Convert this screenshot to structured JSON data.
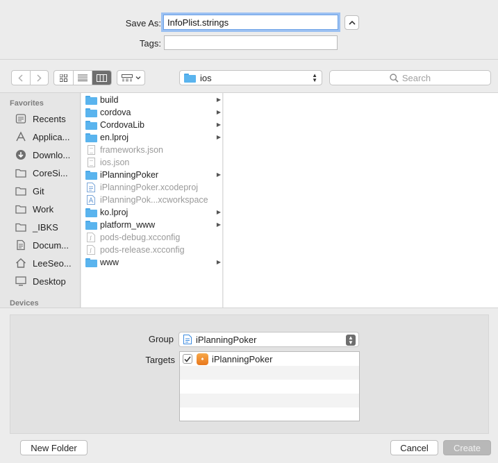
{
  "save": {
    "label": "Save As:",
    "value": "InfoPlist.strings",
    "tags_label": "Tags:",
    "tags_value": ""
  },
  "toolbar": {
    "location": "ios",
    "search_placeholder": "Search"
  },
  "sidebar": {
    "favorites_heading": "Favorites",
    "devices_heading": "Devices",
    "items": [
      {
        "label": "Recents",
        "icon": "recents-icon"
      },
      {
        "label": "Applica...",
        "icon": "applications-icon"
      },
      {
        "label": "Downlo...",
        "icon": "downloads-icon"
      },
      {
        "label": "CoreSi...",
        "icon": "folder-icon"
      },
      {
        "label": "Git",
        "icon": "folder-icon"
      },
      {
        "label": "Work",
        "icon": "folder-icon"
      },
      {
        "label": "_IBKS",
        "icon": "folder-icon"
      },
      {
        "label": "Docum...",
        "icon": "documents-icon"
      },
      {
        "label": "LeeSeo...",
        "icon": "home-icon"
      },
      {
        "label": "Desktop",
        "icon": "desktop-icon"
      }
    ]
  },
  "files": [
    {
      "name": "build",
      "type": "folder",
      "enabled": true
    },
    {
      "name": "cordova",
      "type": "folder",
      "enabled": true
    },
    {
      "name": "CordovaLib",
      "type": "folder",
      "enabled": true
    },
    {
      "name": "en.lproj",
      "type": "folder",
      "enabled": true
    },
    {
      "name": "frameworks.json",
      "type": "file",
      "enabled": false
    },
    {
      "name": "ios.json",
      "type": "file",
      "enabled": false
    },
    {
      "name": "iPlanningPoker",
      "type": "folder",
      "enabled": true
    },
    {
      "name": "iPlanningPoker.xcodeproj",
      "type": "file",
      "enabled": false
    },
    {
      "name": "iPlanningPok...xcworkspace",
      "type": "file",
      "enabled": false
    },
    {
      "name": "ko.lproj",
      "type": "folder",
      "enabled": true
    },
    {
      "name": "platform_www",
      "type": "folder",
      "enabled": true
    },
    {
      "name": "pods-debug.xcconfig",
      "type": "file",
      "enabled": false
    },
    {
      "name": "pods-release.xcconfig",
      "type": "file",
      "enabled": false
    },
    {
      "name": "www",
      "type": "folder",
      "enabled": true
    }
  ],
  "options": {
    "group_label": "Group",
    "group_value": "iPlanningPoker",
    "targets_label": "Targets",
    "targets": [
      {
        "name": "iPlanningPoker",
        "checked": true
      }
    ]
  },
  "buttons": {
    "new_folder": "New Folder",
    "cancel": "Cancel",
    "create": "Create"
  }
}
